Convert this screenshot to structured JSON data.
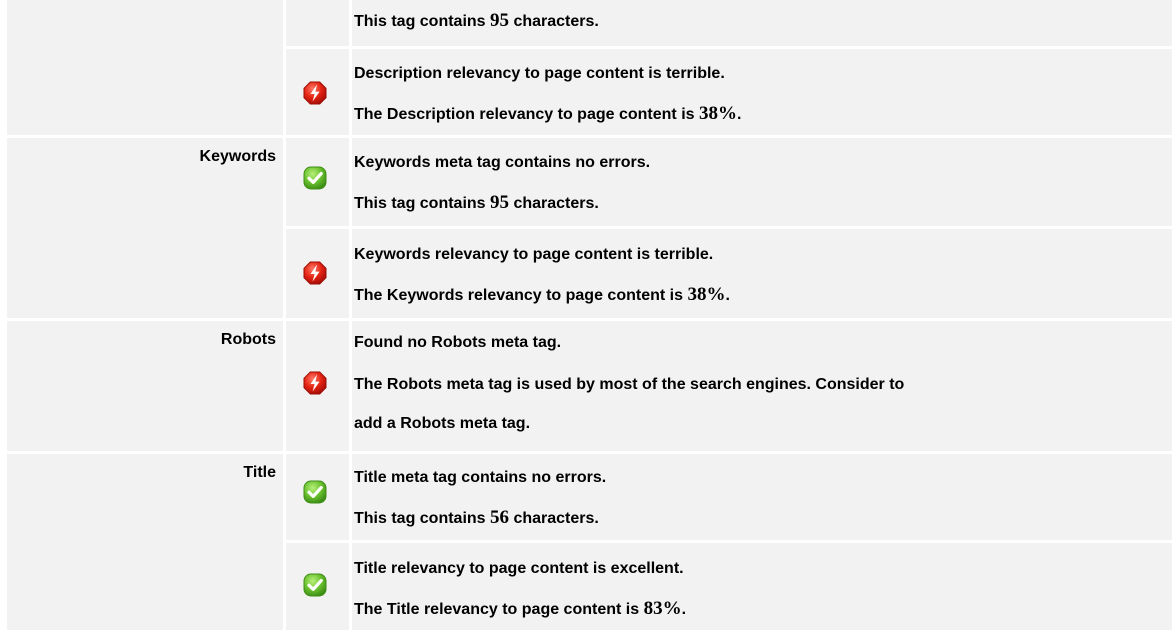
{
  "rows": {
    "description": {
      "label": "",
      "length_check": {
        "status": "ok",
        "icon": "none",
        "line2_pre": "This tag contains ",
        "line2_num": "95",
        "line2_post": " characters."
      },
      "relevancy_check": {
        "status": "error",
        "icon": "error-icon",
        "line1": "Description relevancy to page content is terrible.",
        "line2_pre": "The Description relevancy to page content is ",
        "line2_num": "38%",
        "line2_post": "."
      }
    },
    "keywords": {
      "label": "Keywords",
      "length_check": {
        "status": "ok",
        "icon": "check-icon",
        "line1": "Keywords meta tag contains no errors.",
        "line2_pre": "This tag contains ",
        "line2_num": "95",
        "line2_post": " characters."
      },
      "relevancy_check": {
        "status": "error",
        "icon": "error-icon",
        "line1": "Keywords relevancy to page content is terrible.",
        "line2_pre": "The Keywords relevancy to page content is ",
        "line2_num": "38%",
        "line2_post": "."
      }
    },
    "robots": {
      "label": "Robots",
      "presence_check": {
        "status": "error",
        "icon": "error-icon",
        "line1": "Found no Robots meta tag.",
        "line2": "The Robots meta tag is used by most of the search engines. Consider to",
        "line3": "add a Robots meta tag."
      }
    },
    "title": {
      "label": "Title",
      "length_check": {
        "status": "ok",
        "icon": "check-icon",
        "line1": "Title meta tag contains no errors.",
        "line2_pre": "This tag contains ",
        "line2_num": "56",
        "line2_post": " characters."
      },
      "relevancy_check": {
        "status": "ok",
        "icon": "check-icon",
        "line1": "Title relevancy to page content is excellent.",
        "line2_pre": "The Title relevancy to page content is ",
        "line2_num": "83%",
        "line2_post": "."
      }
    }
  },
  "colors": {
    "cell_background": "#f2f2f2",
    "error_red": "#dc1d12",
    "ok_green": "#5cb82a"
  }
}
